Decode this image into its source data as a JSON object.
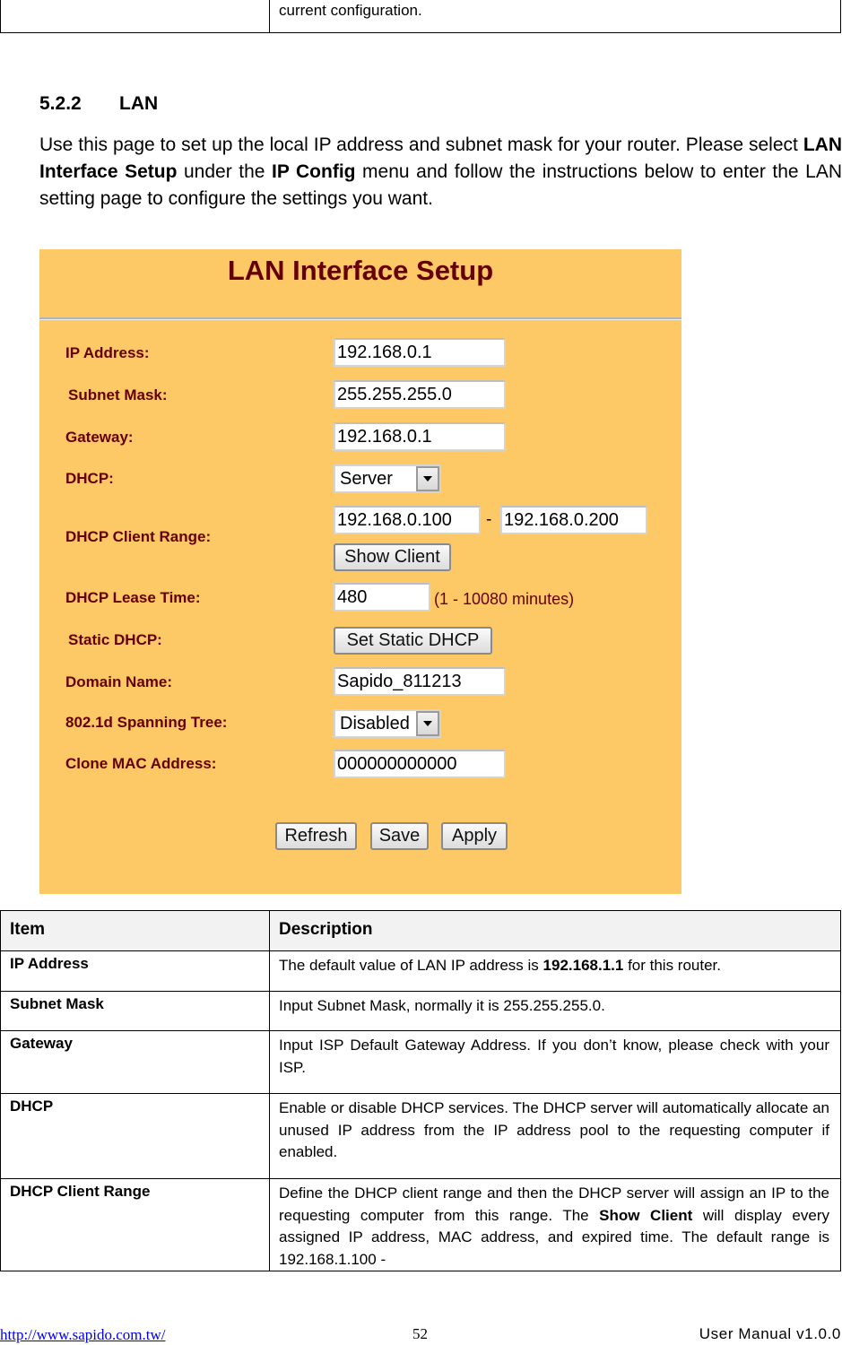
{
  "top_table": {
    "cell_text": "current configuration."
  },
  "section": {
    "number": "5.2.2",
    "title": "LAN"
  },
  "intro": {
    "part1": "Use this page to set up the local IP address and subnet mask for your router. Please select ",
    "bold1": "LAN Interface Setup",
    "part2": " under the ",
    "bold2": "IP Config",
    "part3": " menu and follow the instructions below to enter the LAN setting page to configure the settings you want."
  },
  "panel": {
    "title": "LAN Interface Setup",
    "background_color": "#fdc966",
    "title_color": "#660000",
    "fields": {
      "ip_address": {
        "label": "IP Address:",
        "value": "192.168.0.1"
      },
      "subnet_mask": {
        "label": "Subnet Mask:",
        "value": "255.255.255.0"
      },
      "gateway": {
        "label": "Gateway:",
        "value": "192.168.0.1"
      },
      "dhcp": {
        "label": "DHCP:",
        "selected": "Server"
      },
      "dhcp_client_range": {
        "label": "DHCP Client Range:",
        "start": "192.168.0.100",
        "separator": "-",
        "end": "192.168.0.200",
        "button": "Show Client"
      },
      "dhcp_lease_time": {
        "label": "DHCP Lease Time:",
        "value": "480",
        "hint": "(1 - 10080 minutes)"
      },
      "static_dhcp": {
        "label": "Static DHCP:",
        "button": "Set Static DHCP"
      },
      "domain_name": {
        "label": "Domain Name:",
        "value": "Sapido_811213"
      },
      "spanning_tree": {
        "label": "802.1d Spanning Tree:",
        "selected": "Disabled"
      },
      "clone_mac": {
        "label": "Clone MAC Address:",
        "value": "000000000000"
      }
    },
    "buttons": {
      "refresh": "Refresh",
      "save": "Save",
      "apply": "Apply"
    }
  },
  "desc_table": {
    "headers": {
      "item": "Item",
      "description": "Description"
    },
    "rows": [
      {
        "item": "IP Address",
        "pre": "The default value of LAN IP address is ",
        "bold": "192.168.1.1",
        "post": " for this router."
      },
      {
        "item": "Subnet Mask",
        "pre": "Input Subnet Mask, normally it is 255.255.255.0.",
        "bold": "",
        "post": ""
      },
      {
        "item": "Gateway",
        "pre": "Input ISP Default Gateway Address. If you don’t know, please check with your ISP.",
        "bold": "",
        "post": ""
      },
      {
        "item": "DHCP",
        "pre": "Enable or disable DHCP services. The DHCP server will automatically allocate an unused IP address from the IP address pool to the requesting computer if enabled.",
        "bold": "",
        "post": ""
      },
      {
        "item": "DHCP Client Range",
        "pre": "Define the DHCP client range and then the DHCP server will assign an IP to the requesting computer from this range. The ",
        "bold": "Show Client",
        "post": " will display every assigned IP address, MAC address, and expired time. The default range is 192.168.1.100 -"
      }
    ]
  },
  "footer": {
    "url": "http://www.sapido.com.tw/",
    "page": "52",
    "manual": "User Manual v1.0.0"
  }
}
